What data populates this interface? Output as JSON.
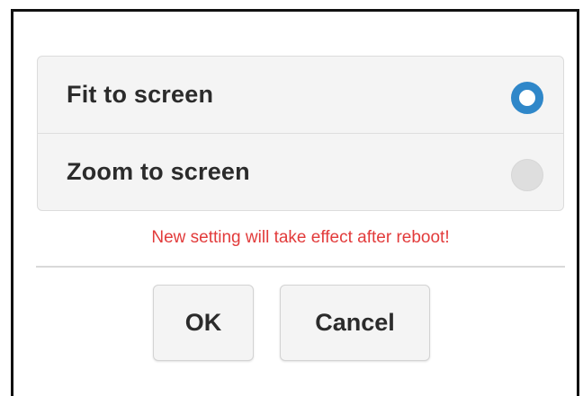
{
  "options": [
    {
      "label": "Fit to screen",
      "selected": true
    },
    {
      "label": "Zoom to screen",
      "selected": false
    }
  ],
  "notice": "New setting will take effect after reboot!",
  "buttons": {
    "ok_label": "OK",
    "cancel_label": "Cancel"
  },
  "colors": {
    "radio_checked": "#2f87c9",
    "notice": "#e23b3b",
    "panel_background": "#f4f4f4"
  }
}
